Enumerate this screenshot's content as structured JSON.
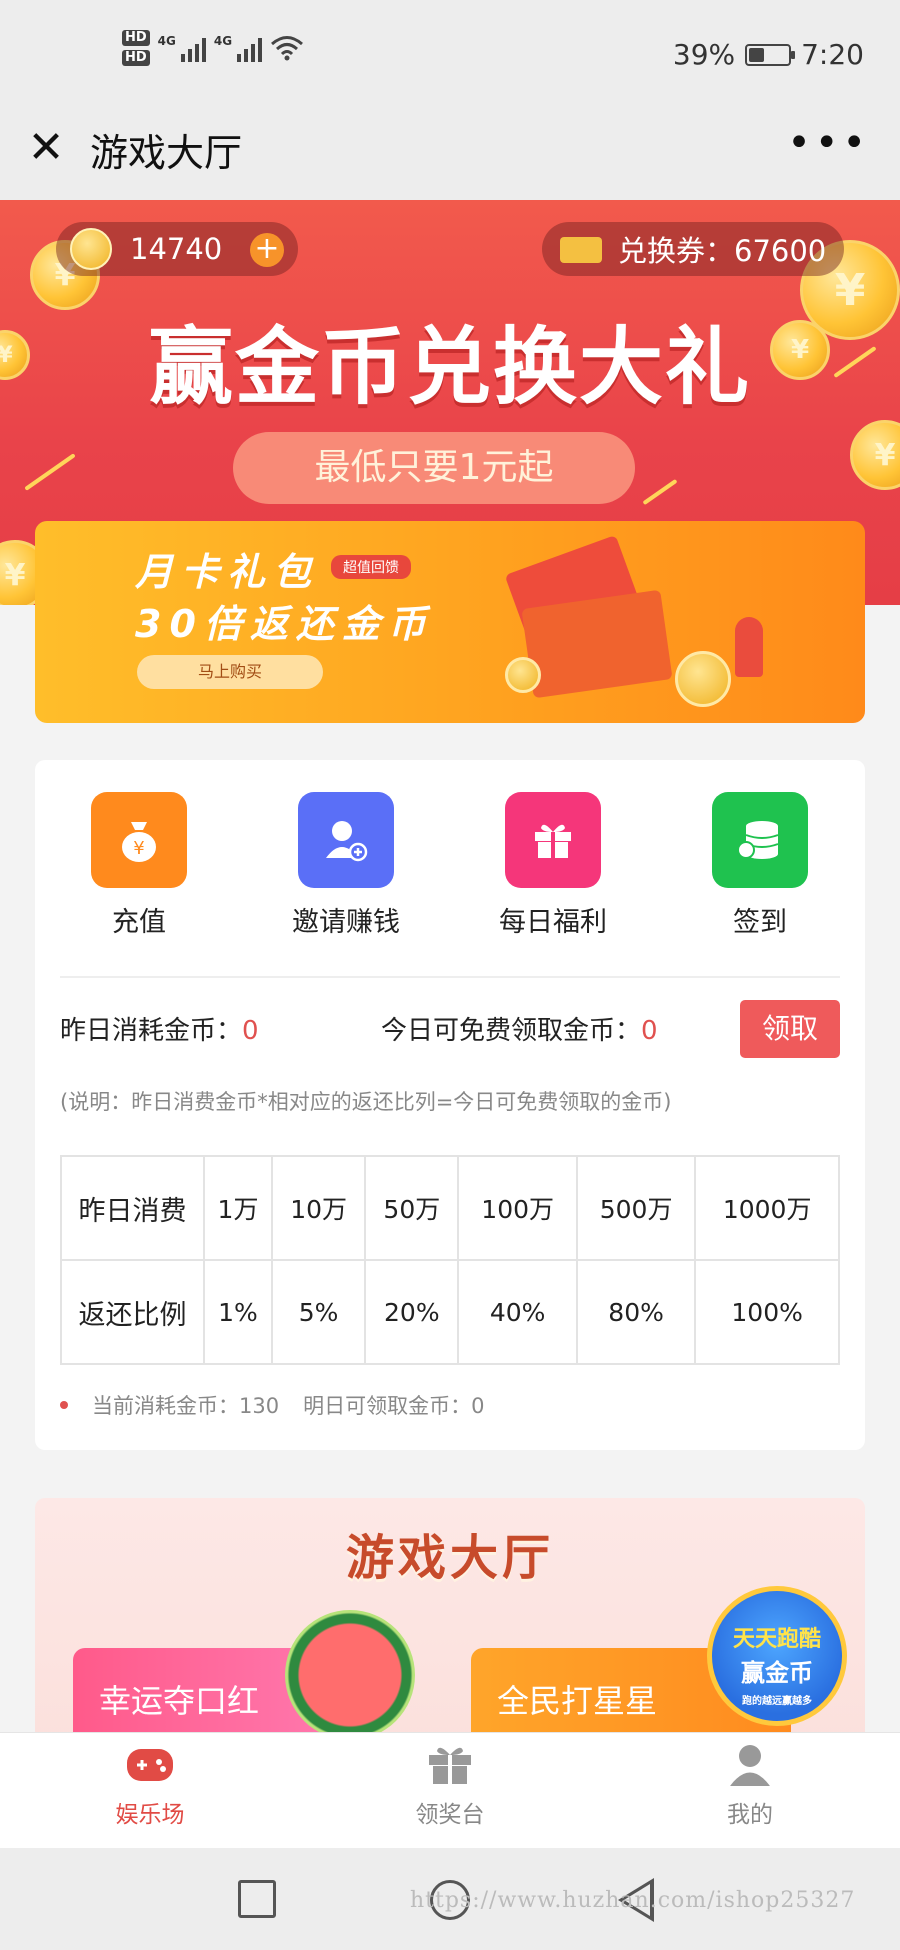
{
  "status_bar": {
    "hd1": "HD",
    "hd2": "HD",
    "net1": "4G",
    "net2": "4G",
    "battery": "39%",
    "battery_level": 0.39,
    "time": "7:20",
    "icons": [
      "signal-icon",
      "wifi-icon",
      "battery-icon"
    ]
  },
  "nav": {
    "title": "游戏大厅",
    "close_icon": "close-icon",
    "more": "•••"
  },
  "banner": {
    "coins": "14740",
    "voucher": "兑换券：67600",
    "title": "赢金币兑换大礼",
    "subtitle": "最低只要1元起"
  },
  "month_card": {
    "line1": "月卡礼包",
    "tag": "超值回馈",
    "line2": "30倍返还金币",
    "button": "马上购买"
  },
  "features": [
    {
      "label": "充值",
      "icon": "money-bag-icon",
      "color": "#ff8a1d"
    },
    {
      "label": "邀请赚钱",
      "icon": "add-user-icon",
      "color": "#5a6ff7"
    },
    {
      "label": "每日福利",
      "icon": "gift-icon",
      "color": "#f5367a"
    },
    {
      "label": "签到",
      "icon": "coins-stack-icon",
      "color": "#1fc24f"
    }
  ],
  "rebate": {
    "yesterday_label": "昨日消耗金币：",
    "yesterday_value": "0",
    "today_label": "今日可免费领取金币：",
    "today_value": "0",
    "claim_button": "领取",
    "note": "(说明：昨日消费金币*相对应的返还比列=今日可免费领取的金币)",
    "table": {
      "row1_header": "昨日消费",
      "row1": [
        "1万",
        "10万",
        "50万",
        "100万",
        "500万",
        "1000万"
      ],
      "row2_header": "返还比例",
      "row2": [
        "1%",
        "5%",
        "20%",
        "40%",
        "80%",
        "100%"
      ]
    },
    "current": "当前消耗金币：130",
    "tomorrow": "明日可领取金币：0"
  },
  "hall": {
    "title": "游戏大厅",
    "games": [
      "幸运夺口红",
      "全民打星星"
    ],
    "badge": {
      "line1": "天天跑酷",
      "line2": "赢金币",
      "line3": "跑的越远赢越多"
    }
  },
  "tabs": [
    {
      "label": "娱乐场",
      "icon": "gamepad-icon",
      "active": true
    },
    {
      "label": "领奖台",
      "icon": "gift-icon",
      "active": false
    },
    {
      "label": "我的",
      "icon": "user-icon",
      "active": false
    }
  ],
  "watermark": "https://www.huzhan.com/ishop25327",
  "colors": {
    "accent": "#e14b45",
    "banner": "#ea4548",
    "claim": "#ef5a5b"
  }
}
